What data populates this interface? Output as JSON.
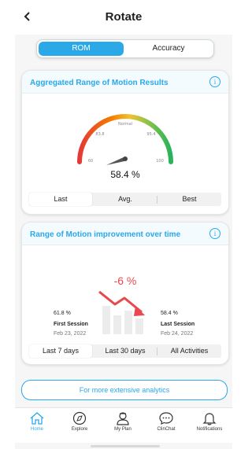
{
  "header": {
    "title": "Rotate",
    "back_icon": "chevron-left-icon"
  },
  "segment": {
    "options": [
      "ROM",
      "Accuracy"
    ],
    "selected": "ROM",
    "accent": "#2aa8e8"
  },
  "rom_card": {
    "title": "Aggregated Range of Motion Results",
    "gauge": {
      "labels": {
        "min": "60",
        "low": "83.8",
        "center": "Normal",
        "high": "95.4",
        "max": "100"
      },
      "value_text": "58.4 %",
      "value": 58.4,
      "range": [
        60,
        100
      ]
    },
    "tabs": [
      "Last",
      "Avg.",
      "Best"
    ],
    "selected_tab": "Last"
  },
  "improve_card": {
    "title": "Range of Motion improvement over time",
    "change": "-6 %",
    "first": {
      "value": "61.8 %",
      "label": "First Session",
      "date": "Feb 23, 2022"
    },
    "last": {
      "value": "58.4 %",
      "label": "Last Session",
      "date": "Feb 24, 2022"
    },
    "tabs": [
      "Last 7 days",
      "Last 30 days",
      "All Activities"
    ],
    "selected_tab": "Last 7 days"
  },
  "cta": {
    "label": "For more extensive analytics"
  },
  "nav": [
    {
      "label": "Home",
      "icon": "home-icon",
      "active": true
    },
    {
      "label": "Explore",
      "icon": "compass-icon",
      "active": false
    },
    {
      "label": "My Plan",
      "icon": "doctor-icon",
      "active": false
    },
    {
      "label": "ClinChat",
      "icon": "chat-bubble-icon",
      "active": false
    },
    {
      "label": "Notifications",
      "icon": "bell-icon",
      "active": false
    }
  ],
  "colors": {
    "accent": "#2aa8e8",
    "negative": "#e8484e"
  }
}
